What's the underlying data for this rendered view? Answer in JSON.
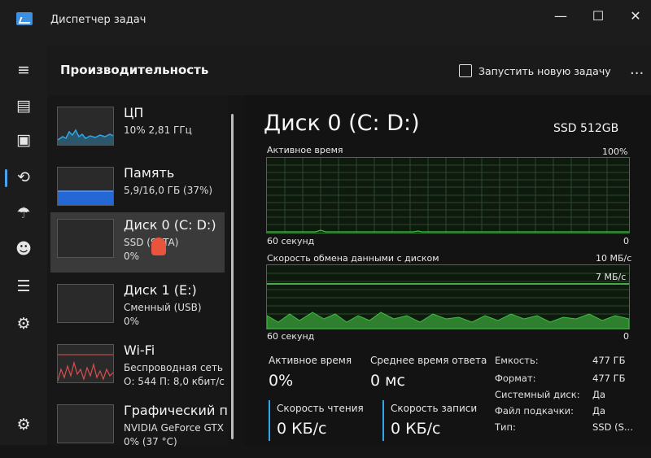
{
  "window": {
    "title": "Диспетчер задач",
    "minimize": "—",
    "maximize": "☐",
    "close": "✕"
  },
  "nav": {
    "menu": "≡",
    "processes": "▤",
    "performance": "▣",
    "history": "⟲",
    "startup": "☂",
    "users": "☻",
    "details": "☰",
    "services": "⚙",
    "settings": "⚙"
  },
  "header": {
    "title": "Производительность",
    "run_task": "Запустить новую задачу",
    "more": "..."
  },
  "devices": [
    {
      "name": "ЦП",
      "sub": "10% 2,81 ГГц",
      "val": ""
    },
    {
      "name": "Память",
      "sub": "5,9/16,0 ГБ (37%)",
      "val": ""
    },
    {
      "name": "Диск 0 (C: D:)",
      "sub": "SSD (SATA)",
      "val": "0%"
    },
    {
      "name": "Диск 1 (E:)",
      "sub": "Сменный (USB)",
      "val": "0%"
    },
    {
      "name": "Wi-Fi",
      "sub": "Беспроводная сеть",
      "val": "О: 544 П: 8,0 кбит/с"
    },
    {
      "name": "Графический п",
      "sub": "NVIDIA GeForce GTX",
      "val": "0% (37 °C)"
    }
  ],
  "detail": {
    "title": "Диск 0 (C: D:)",
    "model": "SSD 512GB",
    "graph1": {
      "label": "Активное время",
      "max": "100%",
      "time": "60 секунд",
      "min": "0"
    },
    "graph2": {
      "label": "Скорость обмена данными с диском",
      "max": "10 МБ/с",
      "mid": "7 МБ/с",
      "time": "60 секунд",
      "min": "0"
    },
    "stats": {
      "active_label": "Активное время",
      "active_value": "0%",
      "resp_label": "Среднее время ответа",
      "resp_value": "0 мс",
      "read_label": "Скорость чтения",
      "read_value": "0 КБ/с",
      "write_label": "Скорость записи",
      "write_value": "0 КБ/с"
    },
    "props": [
      {
        "k": "Емкость:",
        "v": "477 ГБ"
      },
      {
        "k": "Формат:",
        "v": "477 ГБ"
      },
      {
        "k": "Системный диск:",
        "v": "Да"
      },
      {
        "k": "Файл подкачки:",
        "v": "Да"
      },
      {
        "k": "Тип:",
        "v": "SSD (S..."
      }
    ]
  },
  "colors": {
    "accent": "#4aa3f0",
    "disk_green": "#3fbf3f",
    "cpu_blue": "#2fa8e8",
    "mem_blue": "#2468d6",
    "wifi_red": "#d94f4f"
  }
}
